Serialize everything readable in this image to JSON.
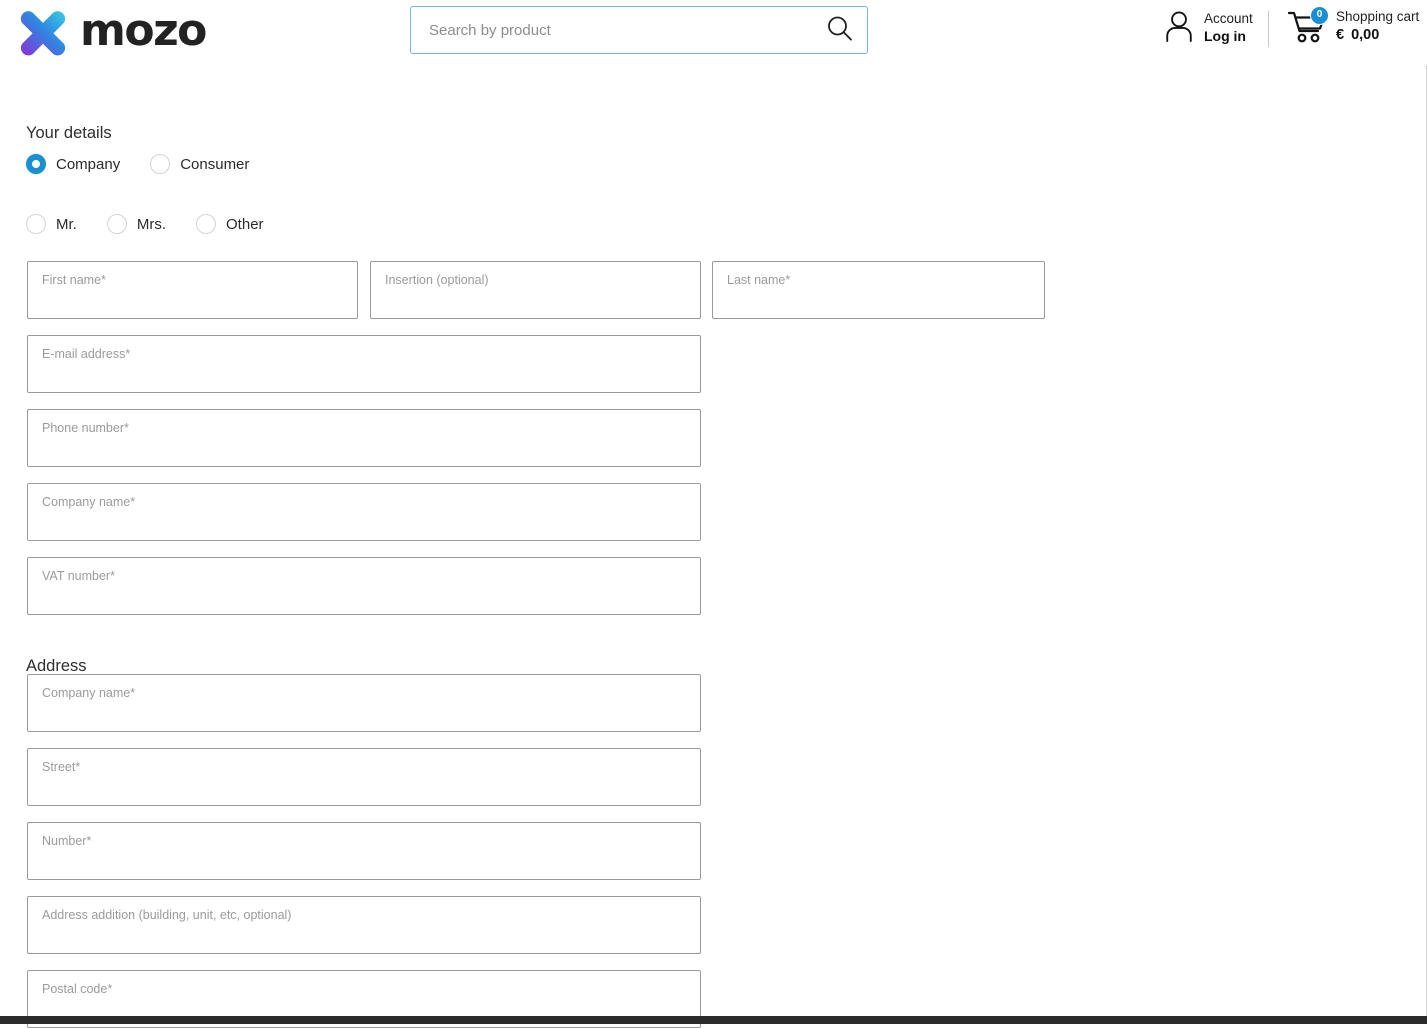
{
  "header": {
    "logo": {
      "text": "mozo",
      "icon": "x-logo-icon",
      "gradient_from": "#35c8e8",
      "gradient_mid": "#2f7de1",
      "gradient_to": "#8b3cd8"
    },
    "search": {
      "placeholder": "Search by product",
      "value": "",
      "icon": "search-icon",
      "border_color": "#76b3dd"
    },
    "account": {
      "icon": "person-icon",
      "top_label": "Account",
      "bottom_label": "Log in"
    },
    "cart": {
      "icon": "shopping-cart-icon",
      "badge_count": "0",
      "badge_color": "#1a8fd1",
      "top_label": "Shopping cart",
      "currency": "€",
      "amount": "0,00"
    }
  },
  "form": {
    "your_details": {
      "title": "Your details",
      "customer_type": {
        "options": [
          {
            "label": "Company",
            "selected": true
          },
          {
            "label": "Consumer",
            "selected": false
          }
        ]
      },
      "salutation": {
        "options": [
          {
            "label": "Mr.",
            "selected": false
          },
          {
            "label": "Mrs.",
            "selected": false
          },
          {
            "label": "Other",
            "selected": false
          }
        ]
      },
      "fields": {
        "first_name": {
          "placeholder": "First name*",
          "value": ""
        },
        "insertion": {
          "placeholder": "Insertion (optional)",
          "value": ""
        },
        "last_name": {
          "placeholder": "Last name*",
          "value": ""
        },
        "email": {
          "placeholder": "E-mail address*",
          "value": ""
        },
        "phone": {
          "placeholder": "Phone number*",
          "value": ""
        },
        "company_name": {
          "placeholder": "Company name*",
          "value": ""
        },
        "vat_number": {
          "placeholder": "VAT number*",
          "value": ""
        }
      }
    },
    "address": {
      "title": "Address",
      "fields": {
        "company_name": {
          "placeholder": "Company name*",
          "value": ""
        },
        "street": {
          "placeholder": "Street*",
          "value": ""
        },
        "number": {
          "placeholder": "Number*",
          "value": ""
        },
        "address_addition": {
          "placeholder": "Address addition (building, unit, etc, optional)",
          "value": ""
        },
        "postal_code": {
          "placeholder": "Postal code*",
          "value": ""
        }
      }
    }
  }
}
